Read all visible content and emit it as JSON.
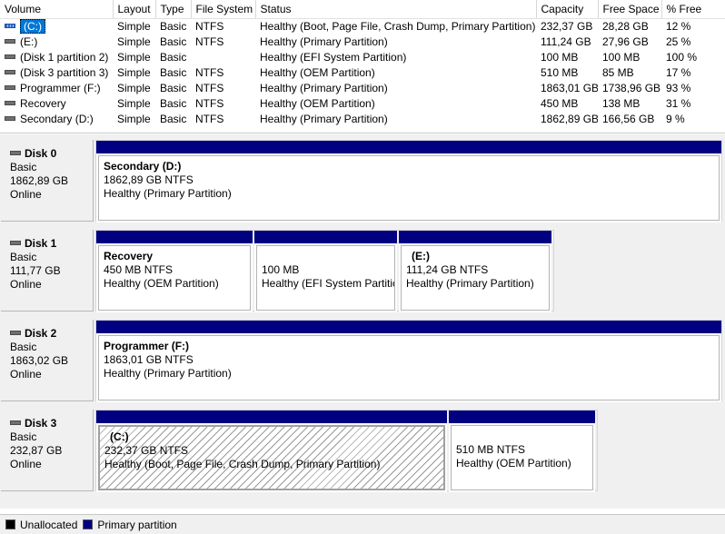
{
  "columns": [
    "Volume",
    "Layout",
    "Type",
    "File System",
    "Status",
    "Capacity",
    "Free Space",
    "% Free"
  ],
  "volumes": [
    {
      "name": "(C:)",
      "layout": "Simple",
      "type": "Basic",
      "fs": "NTFS",
      "status": "Healthy (Boot, Page File, Crash Dump, Primary Partition)",
      "capacity": "232,37 GB",
      "free": "28,28 GB",
      "pct": "12 %",
      "icon": "system-disk-icon",
      "selected": true
    },
    {
      "name": "(E:)",
      "layout": "Simple",
      "type": "Basic",
      "fs": "NTFS",
      "status": "Healthy (Primary Partition)",
      "capacity": "111,24 GB",
      "free": "27,96 GB",
      "pct": "25 %",
      "icon": "disk-icon"
    },
    {
      "name": "(Disk 1 partition 2)",
      "layout": "Simple",
      "type": "Basic",
      "fs": "",
      "status": "Healthy (EFI System Partition)",
      "capacity": "100 MB",
      "free": "100 MB",
      "pct": "100 %",
      "icon": "disk-icon"
    },
    {
      "name": "(Disk 3 partition 3)",
      "layout": "Simple",
      "type": "Basic",
      "fs": "NTFS",
      "status": "Healthy (OEM Partition)",
      "capacity": "510 MB",
      "free": "85 MB",
      "pct": "17 %",
      "icon": "disk-icon"
    },
    {
      "name": "Programmer (F:)",
      "layout": "Simple",
      "type": "Basic",
      "fs": "NTFS",
      "status": "Healthy (Primary Partition)",
      "capacity": "1863,01 GB",
      "free": "1738,96 GB",
      "pct": "93 %",
      "icon": "disk-icon"
    },
    {
      "name": "Recovery",
      "layout": "Simple",
      "type": "Basic",
      "fs": "NTFS",
      "status": "Healthy (OEM Partition)",
      "capacity": "450 MB",
      "free": "138 MB",
      "pct": "31 %",
      "icon": "disk-icon"
    },
    {
      "name": "Secondary (D:)",
      "layout": "Simple",
      "type": "Basic",
      "fs": "NTFS",
      "status": "Healthy (Primary Partition)",
      "capacity": "1862,89 GB",
      "free": "166,56 GB",
      "pct": "9 %",
      "icon": "disk-icon"
    }
  ],
  "disks": [
    {
      "name": "Disk 0",
      "type": "Basic",
      "size": "1862,89 GB",
      "state": "Online",
      "partitions": [
        {
          "title": "Secondary  (D:)",
          "size": "1862,89 GB NTFS",
          "status": "Healthy (Primary Partition)"
        }
      ]
    },
    {
      "name": "Disk 1",
      "type": "Basic",
      "size": "111,77 GB",
      "state": "Online",
      "partitions": [
        {
          "title": "Recovery",
          "size": "450 MB NTFS",
          "status": "Healthy (OEM Partition)"
        },
        {
          "title": "",
          "size": "100 MB",
          "status": "Healthy (EFI System Partitic"
        },
        {
          "title": "(E:)",
          "size": "111,24 GB NTFS",
          "status": "Healthy (Primary Partition)"
        }
      ]
    },
    {
      "name": "Disk 2",
      "type": "Basic",
      "size": "1863,02 GB",
      "state": "Online",
      "partitions": [
        {
          "title": "Programmer  (F:)",
          "size": "1863,01 GB NTFS",
          "status": "Healthy (Primary Partition)"
        }
      ]
    },
    {
      "name": "Disk 3",
      "type": "Basic",
      "size": "232,87 GB",
      "state": "Online",
      "partitions": [
        {
          "title": "(C:)",
          "size": "232,37 GB NTFS",
          "status": "Healthy (Boot, Page File, Crash Dump, Primary Partition)",
          "selected": true
        },
        {
          "title": "",
          "size": "510 MB NTFS",
          "status": "Healthy (OEM Partition)"
        }
      ]
    }
  ],
  "legend": [
    {
      "label": "Unallocated",
      "color": "#000000"
    },
    {
      "label": "Primary partition",
      "color": "#000080"
    }
  ]
}
